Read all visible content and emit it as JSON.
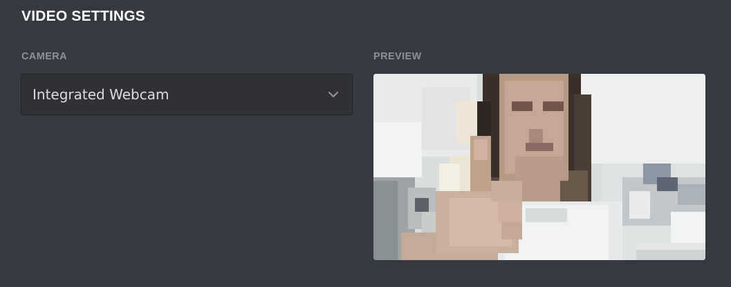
{
  "video_settings": {
    "title": "VIDEO SETTINGS",
    "camera": {
      "label": "CAMERA",
      "selected": "Integrated Webcam",
      "icon": "chevron-down-icon"
    },
    "preview": {
      "label": "PREVIEW"
    }
  }
}
